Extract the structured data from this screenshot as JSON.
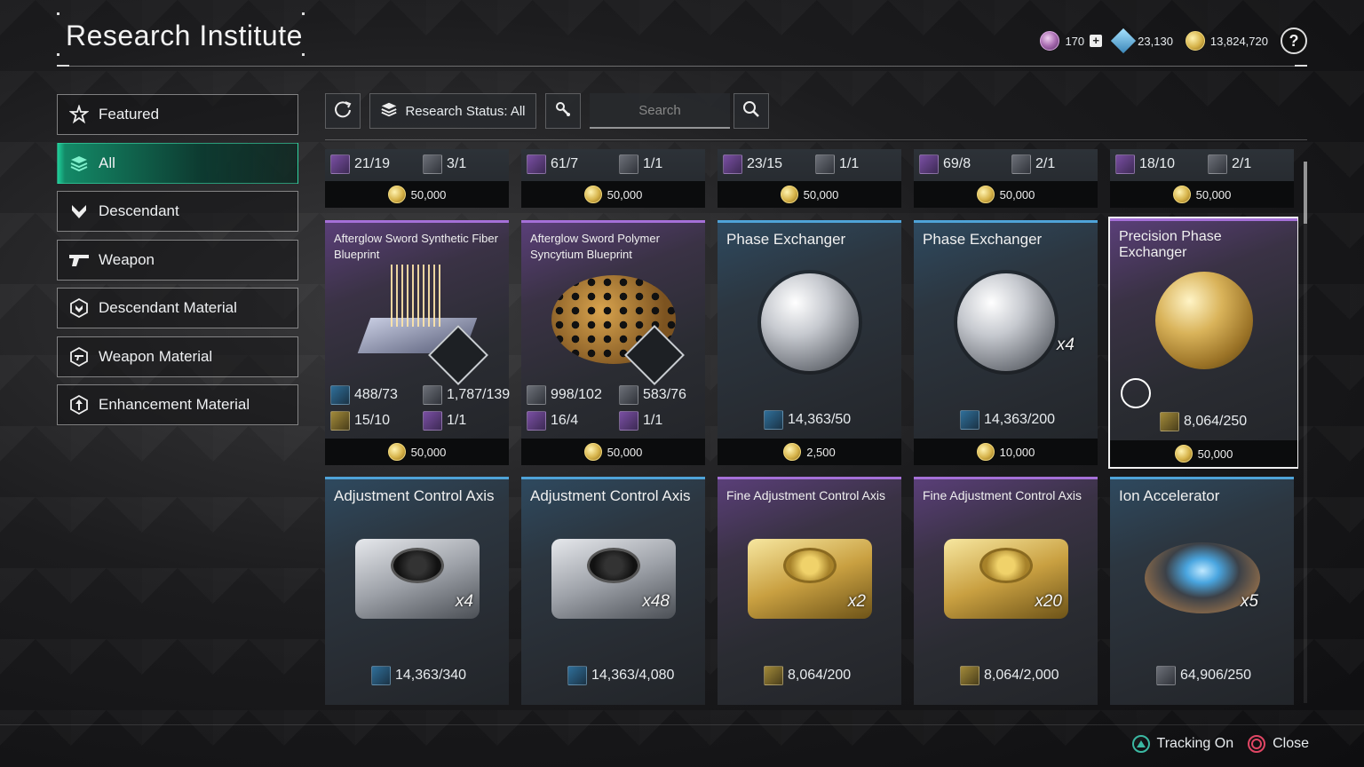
{
  "header": {
    "title": "Research Institute",
    "currencies": [
      {
        "icon": "purple-crystal-icon",
        "value": "170"
      },
      {
        "icon": "blue-shard-icon",
        "value": "23,130"
      },
      {
        "icon": "gold-coin-icon",
        "value": "13,824,720"
      }
    ],
    "help_label": "?"
  },
  "sidebar": {
    "items": [
      {
        "label": "Featured",
        "icon": "featured-icon"
      },
      {
        "label": "All",
        "icon": "layers-icon",
        "active": true
      },
      {
        "label": "Descendant",
        "icon": "descendant-icon"
      },
      {
        "label": "Weapon",
        "icon": "gun-icon"
      },
      {
        "label": "Descendant Material",
        "icon": "descendant-material-icon"
      },
      {
        "label": "Weapon Material",
        "icon": "weapon-material-icon"
      },
      {
        "label": "Enhancement Material",
        "icon": "enhancement-material-icon"
      }
    ]
  },
  "toolbar": {
    "status_label": "Research Status: All",
    "search_placeholder": "Search"
  },
  "row0": [
    {
      "m1": "21/19",
      "m2": "3/1",
      "price": "50,000"
    },
    {
      "m1": "61/7",
      "m2": "1/1",
      "price": "50,000"
    },
    {
      "m1": "23/15",
      "m2": "1/1",
      "price": "50,000"
    },
    {
      "m1": "69/8",
      "m2": "2/1",
      "price": "50,000"
    },
    {
      "m1": "18/10",
      "m2": "2/1",
      "price": "50,000"
    }
  ],
  "row1": [
    {
      "name": "Afterglow Sword Synthetic Fiber Blueprint",
      "mats": [
        "488/73",
        "1,787/139",
        "15/10",
        "1/1"
      ],
      "price": "50,000"
    },
    {
      "name": "Afterglow Sword Polymer Syncytium Blueprint",
      "mats": [
        "998/102",
        "583/76",
        "16/4",
        "1/1"
      ],
      "price": "50,000"
    },
    {
      "name": "Phase Exchanger",
      "mat": "14,363/50",
      "price": "2,500"
    },
    {
      "name": "Phase Exchanger",
      "mat": "14,363/200",
      "price": "10,000",
      "qty": "x4"
    },
    {
      "name": "Precision Phase Exchanger",
      "mat": "8,064/250",
      "price": "50,000"
    }
  ],
  "row2": [
    {
      "name": "Adjustment Control Axis",
      "mat": "14,363/340",
      "qty": "x4"
    },
    {
      "name": "Adjustment Control Axis",
      "mat": "14,363/4,080",
      "qty": "x48"
    },
    {
      "name": "Fine Adjustment Control Axis",
      "mat": "8,064/200",
      "qty": "x2"
    },
    {
      "name": "Fine Adjustment Control Axis",
      "mat": "8,064/2,000",
      "qty": "x20"
    },
    {
      "name": "Ion Accelerator",
      "mat": "64,906/250",
      "qty": "x5"
    }
  ],
  "footer": {
    "tracking_label": "Tracking On",
    "close_label": "Close"
  },
  "colors": {
    "accent_green": "#1fcf9a",
    "rarity_purple": "#a570d8",
    "rarity_blue": "#4fa3d8",
    "tracking_teal": "#3bb8a2",
    "close_pink": "#e04664"
  }
}
